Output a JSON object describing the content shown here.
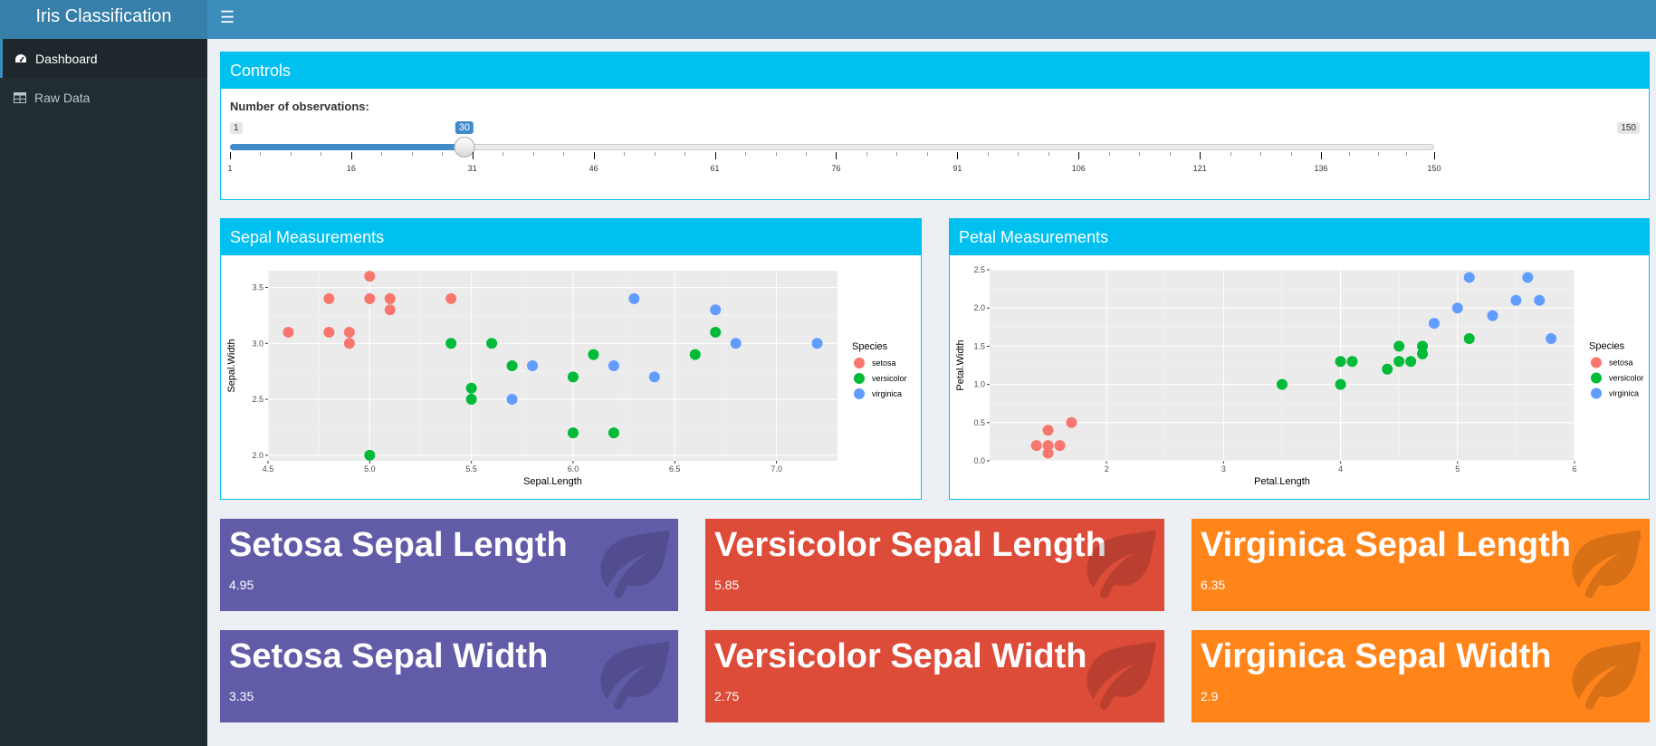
{
  "app": {
    "title": "Iris Classification"
  },
  "sidebar": {
    "items": [
      {
        "label": "Dashboard",
        "icon": "dashboard-icon",
        "active": true
      },
      {
        "label": "Raw Data",
        "icon": "table-icon",
        "active": false
      }
    ]
  },
  "controls": {
    "title": "Controls",
    "slider": {
      "label": "Number of observations:",
      "min": 1,
      "max": 150,
      "value": 30,
      "ticks": [
        1,
        16,
        31,
        46,
        61,
        76,
        91,
        106,
        121,
        136,
        150
      ],
      "min_label": "1",
      "max_label": "150",
      "value_label": "30"
    }
  },
  "sepal": {
    "title": "Sepal Measurements"
  },
  "petal": {
    "title": "Petal Measurements"
  },
  "colors": {
    "setosa": "#f8766d",
    "versicolor": "#00ba38",
    "virginica": "#619cff",
    "header": "#00c0ef"
  },
  "chart_data": [
    {
      "type": "scatter",
      "title": "",
      "xlabel": "Sepal.Length",
      "ylabel": "Sepal.Width",
      "xlim": [
        4.5,
        7.3
      ],
      "ylim": [
        1.95,
        3.65
      ],
      "xticks": [
        "4.5",
        "5.0",
        "5.5",
        "6.0",
        "6.5",
        "7.0"
      ],
      "yticks": [
        "2.0",
        "2.5",
        "3.0",
        "3.5"
      ],
      "legend": {
        "title": "Species",
        "position": "right",
        "entries": [
          "setosa",
          "versicolor",
          "virginica"
        ]
      },
      "grid": true,
      "series": [
        {
          "name": "setosa",
          "points": [
            [
              4.6,
              3.1
            ],
            [
              4.8,
              3.4
            ],
            [
              4.8,
              3.1
            ],
            [
              4.9,
              3.1
            ],
            [
              4.9,
              3.0
            ],
            [
              5.0,
              3.6
            ],
            [
              5.0,
              3.4
            ],
            [
              5.1,
              3.4
            ],
            [
              5.1,
              3.3
            ],
            [
              5.4,
              3.4
            ]
          ]
        },
        {
          "name": "versicolor",
          "points": [
            [
              5.0,
              2.0
            ],
            [
              5.4,
              3.0
            ],
            [
              5.5,
              2.6
            ],
            [
              5.5,
              2.5
            ],
            [
              5.6,
              3.0
            ],
            [
              5.7,
              2.8
            ],
            [
              6.0,
              2.7
            ],
            [
              6.0,
              2.2
            ],
            [
              6.1,
              2.9
            ],
            [
              6.2,
              2.2
            ],
            [
              6.6,
              2.9
            ],
            [
              6.7,
              3.1
            ]
          ]
        },
        {
          "name": "virginica",
          "points": [
            [
              5.7,
              2.5
            ],
            [
              5.8,
              2.8
            ],
            [
              6.2,
              2.8
            ],
            [
              6.3,
              3.4
            ],
            [
              6.4,
              2.7
            ],
            [
              6.7,
              3.3
            ],
            [
              6.8,
              3.0
            ],
            [
              7.2,
              3.0
            ]
          ]
        }
      ]
    },
    {
      "type": "scatter",
      "title": "",
      "xlabel": "Petal.Length",
      "ylabel": "Petal.Width",
      "xlim": [
        1.0,
        6.0
      ],
      "ylim": [
        0.0,
        2.5
      ],
      "xticks": [
        "2",
        "3",
        "4",
        "5",
        "6"
      ],
      "yticks": [
        "0.0",
        "0.5",
        "1.0",
        "1.5",
        "2.0",
        "2.5"
      ],
      "legend": {
        "title": "Species",
        "position": "right",
        "entries": [
          "setosa",
          "versicolor",
          "virginica"
        ]
      },
      "grid": true,
      "series": [
        {
          "name": "setosa",
          "points": [
            [
              1.4,
              0.2
            ],
            [
              1.5,
              0.2
            ],
            [
              1.5,
              0.1
            ],
            [
              1.5,
              0.4
            ],
            [
              1.6,
              0.2
            ],
            [
              1.7,
              0.5
            ]
          ]
        },
        {
          "name": "versicolor",
          "points": [
            [
              3.5,
              1.0
            ],
            [
              4.0,
              1.3
            ],
            [
              4.0,
              1.0
            ],
            [
              4.1,
              1.3
            ],
            [
              4.4,
              1.2
            ],
            [
              4.5,
              1.5
            ],
            [
              4.5,
              1.3
            ],
            [
              4.6,
              1.3
            ],
            [
              4.7,
              1.5
            ],
            [
              4.7,
              1.4
            ],
            [
              5.1,
              1.6
            ]
          ]
        },
        {
          "name": "virginica",
          "points": [
            [
              4.8,
              1.8
            ],
            [
              5.0,
              2.0
            ],
            [
              5.1,
              2.4
            ],
            [
              5.3,
              1.9
            ],
            [
              5.5,
              2.1
            ],
            [
              5.6,
              2.4
            ],
            [
              5.7,
              2.1
            ],
            [
              5.8,
              1.6
            ]
          ]
        }
      ]
    }
  ],
  "stats": [
    {
      "title": "Setosa Sepal Length",
      "value": "4.95",
      "color": "purple"
    },
    {
      "title": "Versicolor Sepal Length",
      "value": "5.85",
      "color": "red"
    },
    {
      "title": "Virginica Sepal Length",
      "value": "6.35",
      "color": "orange"
    },
    {
      "title": "Setosa Sepal Width",
      "value": "3.35",
      "color": "purple"
    },
    {
      "title": "Versicolor Sepal Width",
      "value": "2.75",
      "color": "red"
    },
    {
      "title": "Virginica Sepal Width",
      "value": "2.9",
      "color": "orange"
    }
  ]
}
